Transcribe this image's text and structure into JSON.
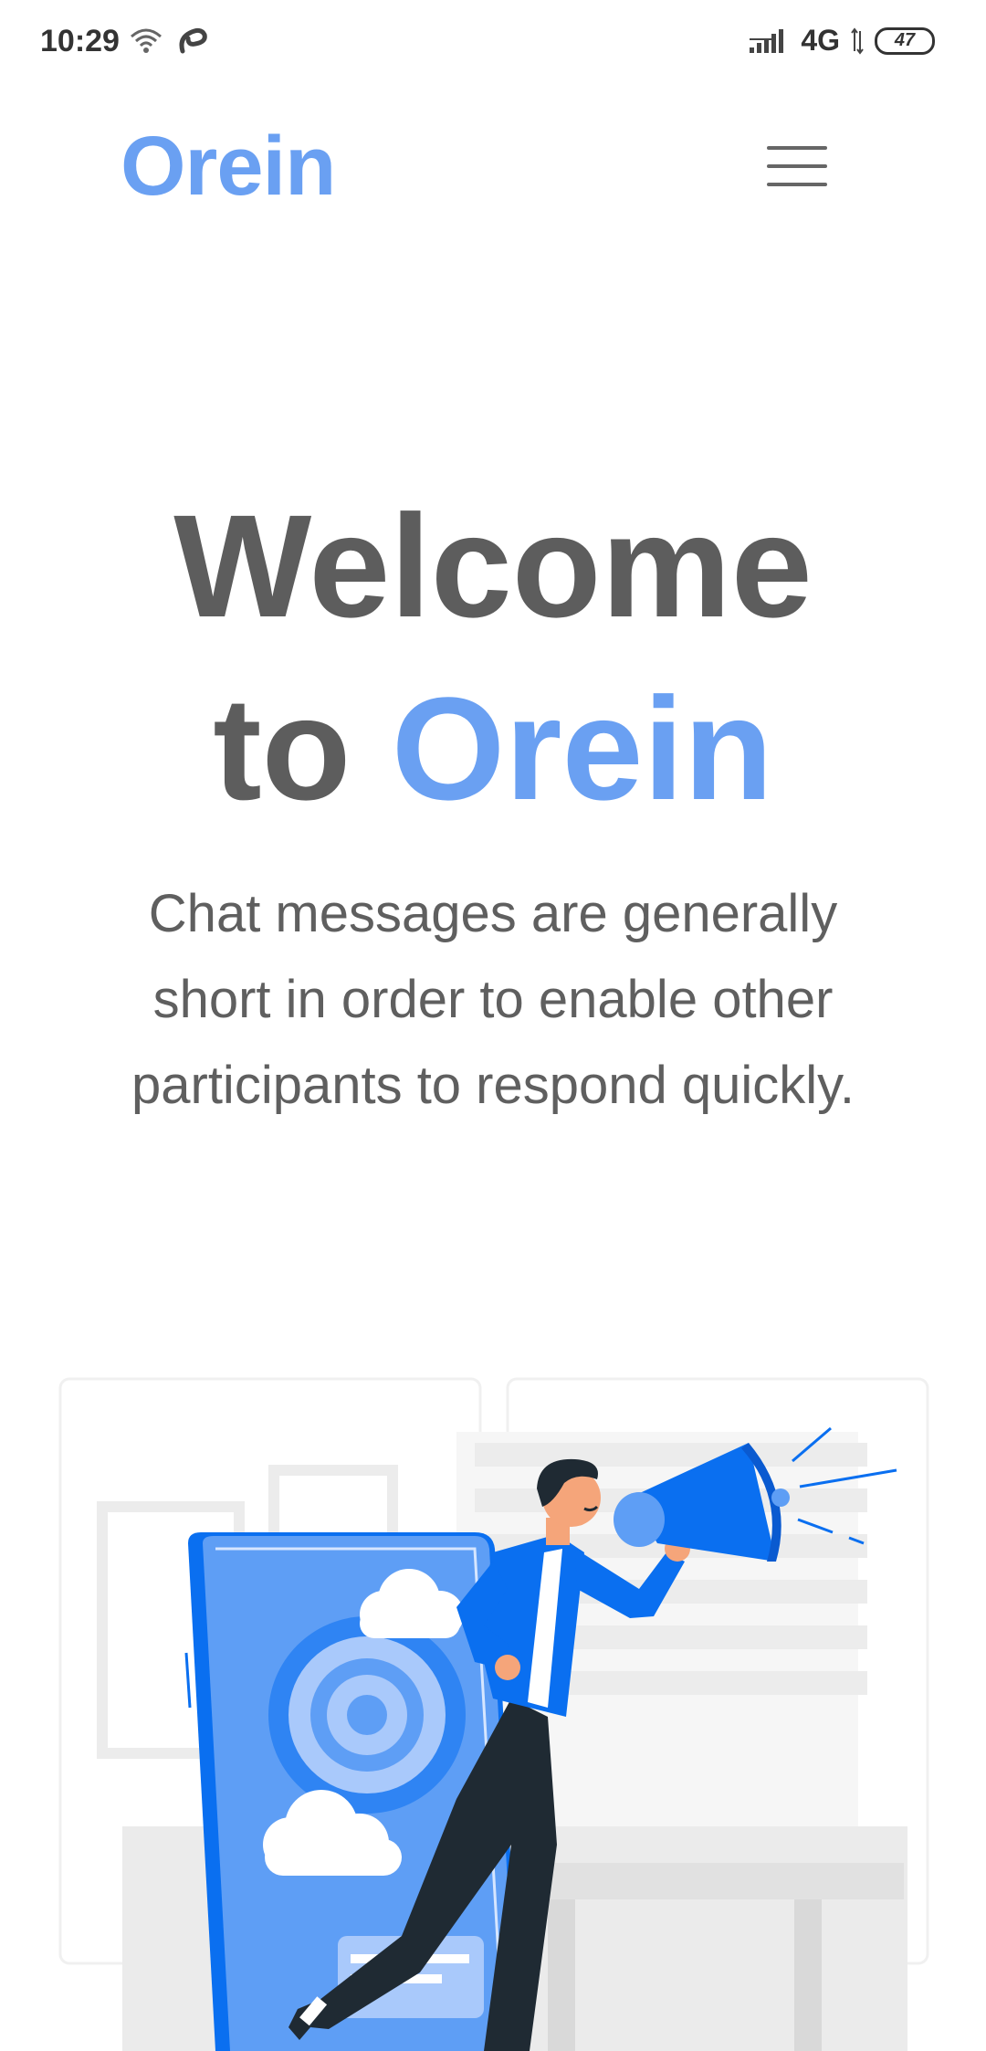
{
  "status_bar": {
    "time": "10:29",
    "network": "4G",
    "battery": "47",
    "icons": [
      "wifi-icon",
      "airtel-icon",
      "signal-icon",
      "battery-icon"
    ]
  },
  "header": {
    "brand": "Orein",
    "menu_icon": "hamburger-menu-icon"
  },
  "hero": {
    "title_line1": "Welcome",
    "title_to": "to",
    "title_brand": "Orein",
    "subtitle": "Chat messages are generally short in order to enable other participants to respond quickly."
  },
  "illustration": {
    "icon": "marketing-megaphone-illustration"
  },
  "colors": {
    "accent": "#6aa0f2",
    "heading": "#5d5d5d",
    "body_text": "#5f5f5f",
    "illustration_blue": "#0a6ff0",
    "illustration_light_blue": "#5e9ef5"
  }
}
